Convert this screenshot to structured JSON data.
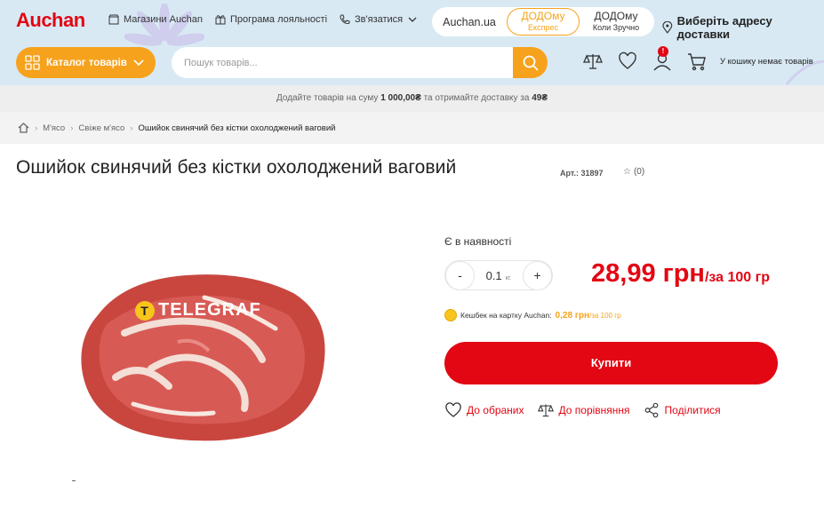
{
  "header": {
    "logo": "Auchan",
    "nav": [
      {
        "label": "Магазини Auchan",
        "icon": "store-icon"
      },
      {
        "label": "Програма лояльності",
        "icon": "gift-icon"
      },
      {
        "label": "Зв'язатися",
        "icon": "phone-icon"
      }
    ],
    "site_tabs": {
      "auchan": "Auchan.ua",
      "express_title": "ДОДОму",
      "express_sub": "Експрес",
      "convenient_title": "ДОДОму",
      "convenient_sub": "Коли Зручно"
    },
    "delivery": "Виберіть адресу доставки",
    "catalog": "Каталог товарів",
    "search_placeholder": "Пошук товарів...",
    "notification_count": "!",
    "cart_text": "У кошику немає товарів"
  },
  "promo": {
    "prefix": "Додайте товарів на суму",
    "amount": "1 000,00₴",
    "middle": "та отримайте доставку за",
    "fee": "49₴"
  },
  "breadcrumb": {
    "items": [
      "М'ясо",
      "Свіже м'ясо"
    ],
    "current": "Ошийок свинячий без кістки охолоджений ваговий"
  },
  "product": {
    "title": "Ошийок свинячий без кістки охолоджений ваговий",
    "article": "Арт.: 31897",
    "rating_count": "(0)",
    "watermark": "TELEGRAF",
    "stock": "Є в наявності",
    "qty_value": "0.1",
    "qty_unit": "кг.",
    "qty_minus": "-",
    "qty_plus": "+",
    "price": "28,99 грн",
    "price_unit": "/за 100 гр",
    "cashback_label": "Кешбек на картку Auchan:",
    "cashback_value": "0,28 грн",
    "cashback_unit": "/за 100 гр",
    "buy": "Купити",
    "favorites": "До обраних",
    "compare": "До порівняння",
    "share": "Поділитися"
  },
  "colors": {
    "brand_red": "#e30613",
    "accent_orange": "#f7a21c",
    "header_bg": "#d8e9f4"
  }
}
